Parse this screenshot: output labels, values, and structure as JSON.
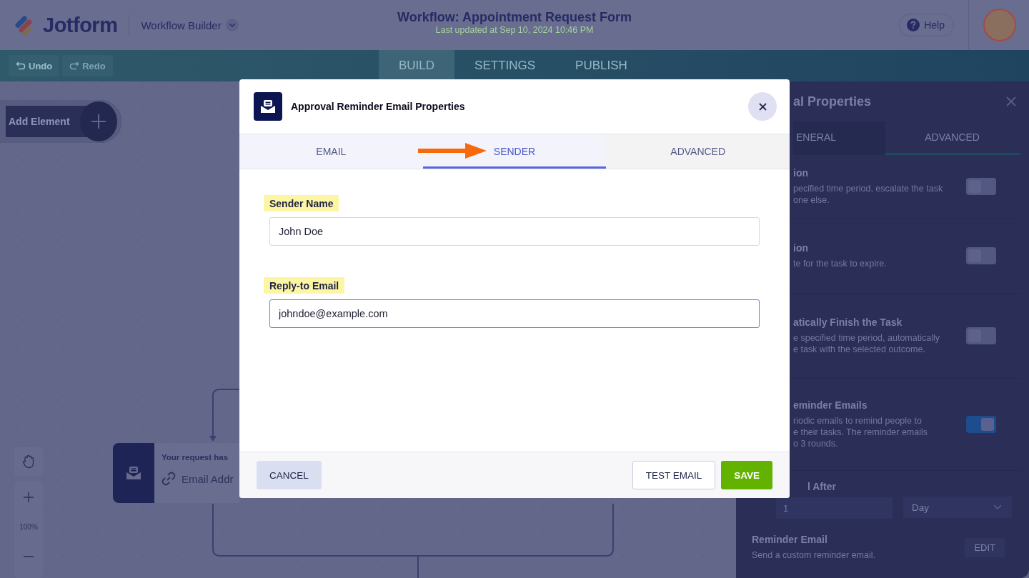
{
  "header": {
    "logo": "Jotform",
    "product": "Workflow Builder",
    "title": "Workflow: Appointment Request Form",
    "subtitle": "Last updated at Sep 10, 2024 10:46 PM",
    "help": "Help"
  },
  "toolbar": {
    "undo": {
      "label": "Undo",
      "disabled": false
    },
    "redo": {
      "label": "Redo",
      "disabled": true
    },
    "tabs": [
      {
        "label": "BUILD",
        "selected": true
      },
      {
        "label": "SETTINGS",
        "selected": false
      },
      {
        "label": "PUBLISH",
        "selected": false
      }
    ]
  },
  "canvas": {
    "add_element": "Add Element",
    "zoom": "100%",
    "node": {
      "title": "Your request has",
      "field": "Email Addr"
    }
  },
  "panel": {
    "title": "al Properties",
    "tabs": [
      {
        "label": "ENERAL",
        "selected": false
      },
      {
        "label": "ADVANCED",
        "selected": true
      }
    ],
    "settings": [
      {
        "title": "ion",
        "desc": [
          "pecified time period, escalate the task",
          "one else."
        ],
        "on": false
      },
      {
        "title": "ion",
        "desc": [
          "te for the task to expire."
        ],
        "on": false
      },
      {
        "title": "atically Finish the Task",
        "desc": [
          "e specified time period, automatically",
          "e task with the selected outcome."
        ],
        "on": false
      },
      {
        "title": "eminder Emails",
        "desc": [
          "riodic emails to remind people to",
          "e their tasks. The reminder emails",
          "o 3 rounds."
        ],
        "on": true
      }
    ],
    "after": {
      "label": "l After",
      "value": "1",
      "unit": "Day"
    },
    "reminder": {
      "title": "Reminder Email",
      "desc": "Send a custom reminder email.",
      "button": "EDIT"
    }
  },
  "modal": {
    "title": "Approval Reminder Email Properties",
    "tabs": [
      {
        "label": "EMAIL",
        "selected": false
      },
      {
        "label": "SENDER",
        "selected": true
      },
      {
        "label": "ADVANCED",
        "selected": false
      }
    ],
    "fields": [
      {
        "label": "Sender Name",
        "value": "John Doe",
        "focused": false
      },
      {
        "label": "Reply-to Email",
        "value": "johndoe@example.com",
        "focused": true
      }
    ],
    "buttons": {
      "cancel": "CANCEL",
      "test": "TEST EMAIL",
      "save": "SAVE"
    }
  }
}
